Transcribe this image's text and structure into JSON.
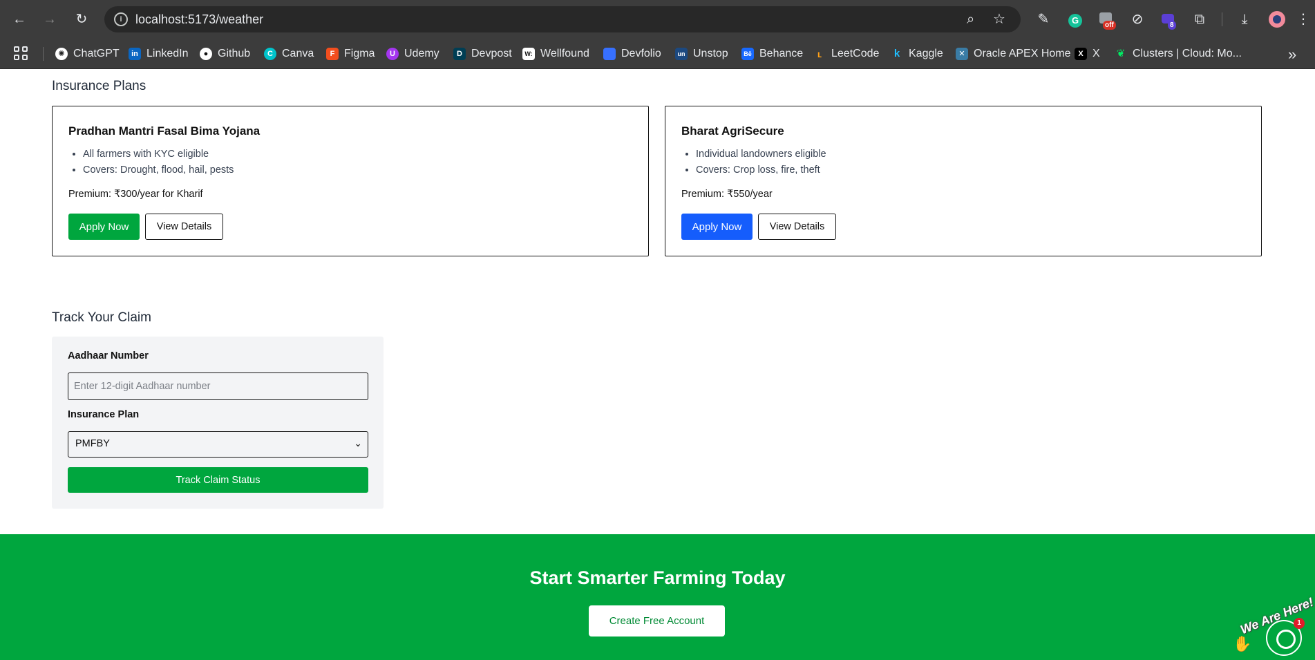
{
  "browser": {
    "url": "localhost:5173/weather",
    "ext_badge_off": "off",
    "ext_badge_count": "8",
    "bookmarks": [
      {
        "label": "ChatGPT",
        "color": "#ffffff"
      },
      {
        "label": "LinkedIn",
        "color": "#0a66c2"
      },
      {
        "label": "Github",
        "color": "#ffffff"
      },
      {
        "label": "Canva",
        "color": "#00c4cc"
      },
      {
        "label": "Figma",
        "color": "#f24e1e"
      },
      {
        "label": "Udemy",
        "color": "#a435f0"
      },
      {
        "label": "Devpost",
        "color": "#003e54"
      },
      {
        "label": "Wellfound",
        "color": "#ffffff"
      },
      {
        "label": "Devfolio",
        "color": "#3770ff"
      },
      {
        "label": "Unstop",
        "color": "#1c4980"
      },
      {
        "label": "Behance",
        "color": "#1769ff"
      },
      {
        "label": "LeetCode",
        "color": "#ffa116"
      },
      {
        "label": "Kaggle",
        "color": "#20beff"
      },
      {
        "label": "Oracle APEX Home",
        "color": "#3a7ca5"
      },
      {
        "label": "X",
        "color": "#000000"
      },
      {
        "label": "Clusters | Cloud: Mo...",
        "color": "#00ed64"
      }
    ]
  },
  "insurance": {
    "title": "Insurance Plans",
    "plans": [
      {
        "name": "Pradhan Mantri Fasal Bima Yojana",
        "points": [
          "All farmers with KYC eligible",
          "Covers: Drought, flood, hail, pests"
        ],
        "premium": "Premium: ₹300/year for Kharif",
        "apply_label": "Apply Now",
        "apply_color": "#00a63e",
        "details_label": "View Details"
      },
      {
        "name": "Bharat AgriSecure",
        "points": [
          "Individual landowners eligible",
          "Covers: Crop loss, fire, theft"
        ],
        "premium": "Premium: ₹550/year",
        "apply_label": "Apply Now",
        "apply_color": "#155dfc",
        "details_label": "View Details"
      }
    ]
  },
  "claim": {
    "title": "Track Your Claim",
    "aadhaar_label": "Aadhaar Number",
    "aadhaar_placeholder": "Enter 12-digit Aadhaar number",
    "plan_label": "Insurance Plan",
    "plan_selected": "PMFBY",
    "track_label": "Track Claim Status"
  },
  "cta": {
    "title": "Start Smarter Farming Today",
    "button_label": "Create Free Account"
  },
  "chat": {
    "tag": "We Are Here!",
    "unread": "1"
  }
}
